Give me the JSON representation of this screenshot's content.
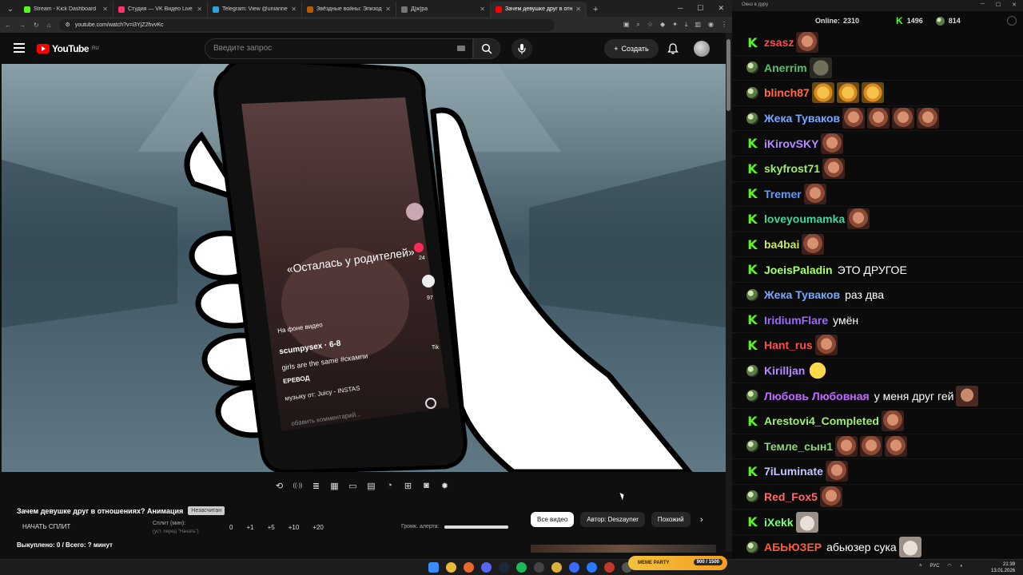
{
  "browser": {
    "tabs": [
      {
        "title": "Stream - Kick Dashboard",
        "color": "#53fc18"
      },
      {
        "title": "Студия — VK Видео Live",
        "color": "#ff3366"
      },
      {
        "title": "Telegram: View @uniannet",
        "color": "#2aa3e0"
      },
      {
        "title": "Звёздные войны: Эпизод 5 -",
        "color": "#b55a00"
      },
      {
        "title": "Д[ж]ра",
        "color": "#777777"
      },
      {
        "title": "Зачем девушке друг в отн",
        "color": "#ff0000"
      }
    ],
    "url": "youtube.com/watch?v=i3YjZ2hvvKc"
  },
  "youtube": {
    "logo_text": "YouTube",
    "region": "RU",
    "search_placeholder": "Введите запрос",
    "create_label": "Создать"
  },
  "video": {
    "overlay_caption": "«Осталась у родителей»",
    "bg_label": "На фоне видео",
    "username": "scumpysex · 6-8",
    "desc": "girls are the same #скампи",
    "translate": "ЕРЕВОД",
    "music": "музыку от: Juicy - INSTAS",
    "comment_placeholder": "обавить комментарий...",
    "side_counts": [
      "24",
      "97",
      "Tik"
    ]
  },
  "below": {
    "title": "Зачем девушке друг в отношениях? Анимация",
    "badge": "Незасчитан",
    "start_split": "НАЧАТЬ СПЛИТ",
    "split_label": "Сплит (мин):",
    "split_sub": "(уст. перед \"Начать\")",
    "split_buttons": [
      "0",
      "+1",
      "+5",
      "+10",
      "+20"
    ],
    "alert_label": "Громк. алерта:",
    "alert_volume": 1.0,
    "sold": "Выкуплено: 0 / Всего: ? минут",
    "chips": [
      "Все видео",
      "Автор: Deszayner",
      "Похожий"
    ],
    "control_icons": [
      "repeat-icon",
      "broadcast-icon",
      "playlist-icon",
      "clapper-icon",
      "pip-icon",
      "subtitles-icon",
      "speed-icon",
      "add-icon",
      "camera-icon",
      "settings-icon"
    ]
  },
  "chat": {
    "window_title": "Окно в дуру",
    "online_label": "Online:",
    "online": "2310",
    "kick_count": "1496",
    "bot_count": "814",
    "messages": [
      {
        "user": "zsasz",
        "color": "#ff4d4d",
        "icon": "kick",
        "text": "",
        "emotes": [
          "face"
        ]
      },
      {
        "user": "Anerrim",
        "color": "#53c268",
        "icon": "bot",
        "text": "",
        "emotes": [
          "frog"
        ]
      },
      {
        "user": "blinch87",
        "color": "#ff6b4a",
        "icon": "bot",
        "text": "",
        "emotes": [
          "laugh",
          "laugh",
          "laugh"
        ]
      },
      {
        "user": "Жека Туваков",
        "color": "#7aa8ff",
        "icon": "bot",
        "text": "",
        "emotes": [
          "face",
          "face",
          "face",
          "face"
        ]
      },
      {
        "user": "iKirovSKY",
        "color": "#b48cff",
        "icon": "kick",
        "text": "",
        "emotes": [
          "face"
        ]
      },
      {
        "user": "skyfrost71",
        "color": "#9cf06a",
        "icon": "kick",
        "text": "",
        "emotes": [
          "face"
        ]
      },
      {
        "user": "Tremer",
        "color": "#5a9cff",
        "icon": "kick",
        "text": "",
        "emotes": [
          "face"
        ]
      },
      {
        "user": "loveyoumamka",
        "color": "#3fd6a3",
        "icon": "kick",
        "text": "",
        "emotes": [
          "face"
        ]
      },
      {
        "user": "ba4bai",
        "color": "#c8e86a",
        "icon": "kick",
        "text": "",
        "emotes": [
          "face"
        ]
      },
      {
        "user": "JoeisPaladin",
        "color": "#a7ff6a",
        "icon": "kick",
        "text": "ЭТО ДРУГОЕ",
        "emotes": []
      },
      {
        "user": "Жека Туваков",
        "color": "#7aa8ff",
        "icon": "bot",
        "text": "раз два",
        "emotes": []
      },
      {
        "user": "IridiumFlare",
        "color": "#9b6aff",
        "icon": "kick",
        "text": "умён",
        "emotes": []
      },
      {
        "user": "Hant_rus",
        "color": "#ff4d4d",
        "icon": "kick",
        "text": "",
        "emotes": [
          "face"
        ]
      },
      {
        "user": "Kirilljan",
        "color": "#b38cff",
        "icon": "bot",
        "text": "",
        "emotes": [
          "cry"
        ]
      },
      {
        "user": "Любовь Любовная",
        "color": "#c06aff",
        "icon": "bot",
        "text": "у меня друг гей",
        "emotes": [
          "man"
        ]
      },
      {
        "user": "Arestovi4_Completed",
        "color": "#9cf06a",
        "icon": "kick",
        "text": "",
        "emotes": [
          "face"
        ]
      },
      {
        "user": "Темле_сын1",
        "color": "#8fd37a",
        "icon": "bot",
        "text": "",
        "emotes": [
          "face",
          "face",
          "face"
        ]
      },
      {
        "user": "7iLuminate",
        "color": "#c6c6ff",
        "icon": "kick",
        "text": "",
        "emotes": [
          "face"
        ]
      },
      {
        "user": "Red_Fox5",
        "color": "#ff6a6a",
        "icon": "bot",
        "text": "",
        "emotes": [
          "face"
        ]
      },
      {
        "user": "iXekk",
        "color": "#7cff7c",
        "icon": "kick",
        "text": "",
        "emotes": [
          "cat"
        ]
      },
      {
        "user": "АБЬЮЗЕР",
        "color": "#ff5a3c",
        "icon": "bot",
        "text": "абьюзер сука",
        "emotes": [
          "cat"
        ]
      }
    ]
  },
  "taskbar": {
    "meme_label": "MEME PARTY",
    "meme_count": "900 / 1500",
    "lang": "РУС",
    "time": "21:39",
    "date": "13.01.2026"
  }
}
